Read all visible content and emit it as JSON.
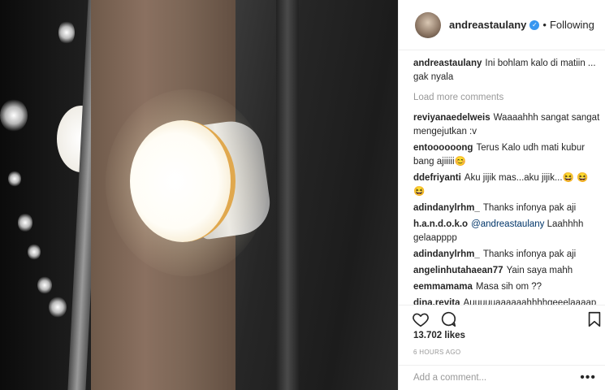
{
  "post": {
    "author": "andreastaulany",
    "follow_status": "Following",
    "caption": "Ini bohlam kalo di matiin ... gak nyala",
    "load_more": "Load more comments",
    "likes": "13.702 likes",
    "time": "6 HOURS AGO",
    "add_comment_placeholder": "Add a comment...",
    "more_label": "•••"
  },
  "comments": [
    {
      "user": "reviyanaedelweis",
      "text": "Waaaahhh sangat sangat mengejutkan :v"
    },
    {
      "user": "entoooooong",
      "text": "Terus Kalo udh mati kubur bang ajiiiii😊"
    },
    {
      "user": "ddefriyanti",
      "text": "Aku jijik mas...aku jijik...😆 😆 😆"
    },
    {
      "user": "adindanylrhm_",
      "text": "Thanks infonya pak aji"
    },
    {
      "user": "h.a.n.d.o.k.o",
      "mention": "@andreastaulany",
      "text": "Laahhhh gelaapppp"
    },
    {
      "user": "adindanylrhm_",
      "text": "Thanks infonya pak aji"
    },
    {
      "user": "angelinhutahaean77",
      "text": "Yain saya mahh"
    },
    {
      "user": "eemmamama",
      "text": "Masa sih om ??"
    },
    {
      "user": "dina.revita",
      "text": "Auuuuuaaaaaahhhhgeeelaaaap pp"
    }
  ],
  "icons": {
    "verified": "verified-badge-icon",
    "like": "heart-icon",
    "comment": "speech-bubble-icon",
    "save": "bookmark-icon"
  },
  "colors": {
    "accent": "#3897f0",
    "muted": "#999999",
    "border": "#efefef"
  }
}
